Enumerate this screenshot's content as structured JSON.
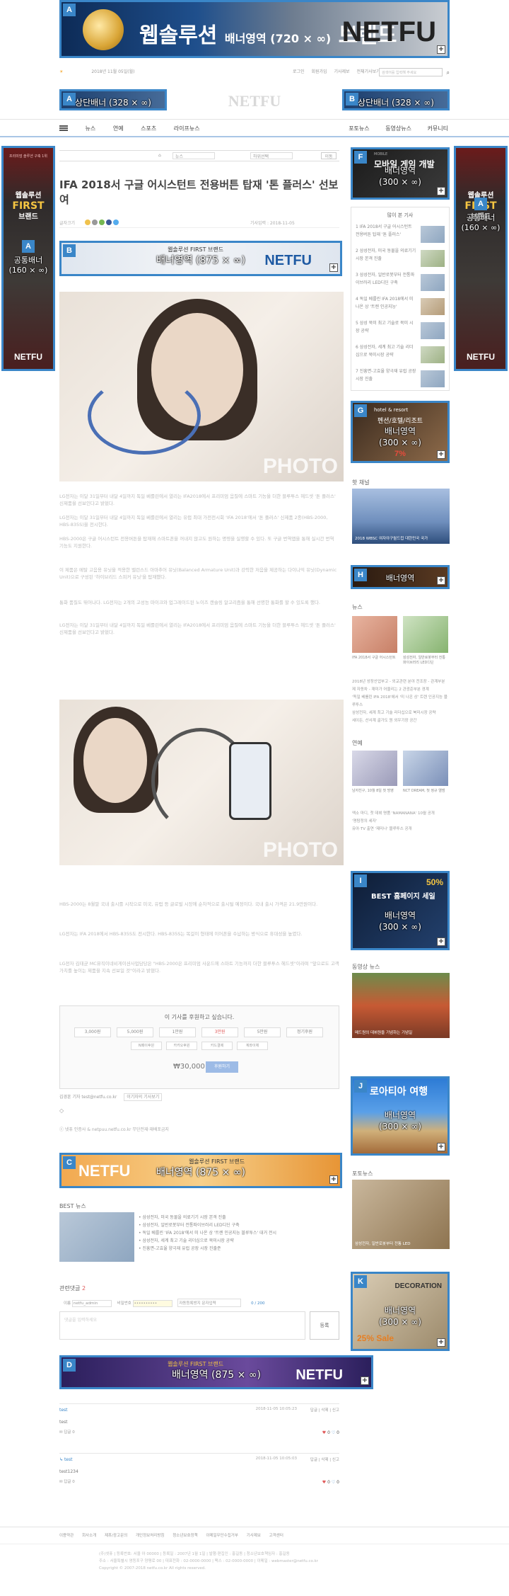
{
  "ads": {
    "top": {
      "tag": "A",
      "text": "웹솔루션",
      "sub": "배너영역 (720 × ∞)",
      "brand_suffix": "브랜드",
      "brand": "NETFU"
    },
    "header_left": {
      "tag": "A",
      "text": "상단배너 (328 × ∞)"
    },
    "header_right": {
      "tag": "B",
      "text": "상단배너 (328 × ∞)"
    },
    "side_left": {
      "tag": "A",
      "line1": "웹솔루션",
      "line2": "FIRST",
      "line3": "브랜드",
      "text1": "공통배너",
      "text2": "(160 × ∞)",
      "brand": "NETFU",
      "top_text": "프리미엄 솔루션 구축 1위"
    },
    "side_right": {
      "tag": "A",
      "line1": "웹솔루션",
      "line2": "FIRST",
      "line3": "브랜드",
      "text1": "공통배너",
      "text2": "(160 × ∞)",
      "brand": "NETFU"
    },
    "article_b": {
      "tag": "B",
      "text": "배너영역 (875 × ∞)",
      "headline": "웹솔루션 FIRST 브랜드",
      "brand": "NETFU"
    },
    "article_c": {
      "tag": "C",
      "text": "배너영역 (875 × ∞)",
      "headline": "웹솔루션 FIRST 브랜드",
      "brand": "NETFU"
    },
    "article_d": {
      "tag": "D",
      "text": "배너영역 (875 × ∞)",
      "headline": "웹솔루션 FIRST 브랜드",
      "brand": "NETFU"
    },
    "right_f": {
      "tag": "F",
      "text1": "배너영역",
      "text2": "(300 × ∞)",
      "top": "MOBILE",
      "headline": "모바일 게임 개발"
    },
    "right_g": {
      "tag": "G",
      "text1": "배너영역",
      "text2": "(300 × ∞)",
      "top": "hotel & resort",
      "headline": "펜션/호텔/리조트",
      "pct": "7%"
    },
    "right_h": {
      "tag": "H",
      "text1": "배너영역"
    },
    "right_i": {
      "tag": "I",
      "text1": "배너영역",
      "text2": "(300 × ∞)",
      "headline": "BEST 홈페이지 세일",
      "pct": "50%"
    },
    "right_j": {
      "tag": "J",
      "text1": "배너영역",
      "text2": "(300 × ∞)",
      "headline": "로아티아 여행"
    },
    "right_k": {
      "tag": "K",
      "text1": "배너영역",
      "text2": "(300 × ∞)",
      "headline": "DECORATION",
      "pct": "25% Sale"
    }
  },
  "header": {
    "date": "2018년 11월 05일(월)",
    "links": [
      "로그인",
      "회원가입",
      "기사제보",
      "전체기사보기"
    ],
    "search_placeholder": "검색어를 입력해 주세요",
    "logo": "NETFU"
  },
  "nav": {
    "left": [
      "뉴스",
      "연예",
      "스포츠",
      "라이프뉴스"
    ],
    "right": [
      "포토뉴스",
      "동영상뉴스",
      "커뮤니티"
    ]
  },
  "article": {
    "breadcrumb": "뉴스",
    "select": "하위선택",
    "select_btn": "이동",
    "title": "IFA 2018서 구글 어시스턴트 전용버튼 탑재 '톤 플러스' 선보여",
    "font_size": "글자크기",
    "date": "기사입력 : 2018-11-05",
    "photo_wm": "PHOTO",
    "paras": [
      "LG전자는 이달 31일부터 내달 4일까지 독일 베를린에서 열리는 IFA2018에서 프리미엄 음질에 스마트 기능을 더한 블루투스 헤드셋 '톤 플러스' 신제품을 선보인다고 밝혔다.",
      "LG전자는 이달 31일부터 내달 4일까지 독일 베를린에서 열리는 유럽 최대 가전전시회 'IFA 2018'에서 '톤 플러스' 신제품 2종(HBS-2000, HBS-835S)을 전시한다.",
      "HBS-2000은 구글 어시스턴트 전용버튼을 탑재해 스마트폰을 꺼내지 않고도 원하는 명령을 실행할 수 있다. 또 구글 번역앱을 통해 실시간 번역 기능도 지원한다.",
      "이 제품은 메탈 고음용 유닛을 적용한 밸런스드 아마추어 유닛(Balanced Armature Unit)과 강력한 저음을 제공하는 다이나믹 유닛(Dynamic Unit)으로 구성된 '하이브리드 스피커 유닛'을 탑재했다.",
      "통화 품질도 뛰어나다. LG전자는 2개의 고성능 마이크와 업그레이드된 노이즈 캔슬링 알고리즘을 통해 선명한 통화를 할 수 있도록 했다.",
      "LG전자는 이달 31일부터 내달 4일까지 독일 베를린에서 열리는 IFA2018에서 프리미엄 음질에 스마트 기능을 더한 블루투스 헤드셋 '톤 플러스' 신제품을 선보인다고 밝혔다.",
      "HBS-2000는 8월말 국내 출시를 시작으로 미국, 유럽 등 글로벌 시장에 순차적으로 출시될 예정이다. 국내 출시 가격은 21.9만원이다.",
      "LG전자는 IFA 2018에서 HBS-835S도 전시한다. HBS-835S는 목걸이 형태에 이어폰을 수납하는 방식으로 휴대성을 높였다.",
      "LG전자 김태균 MC뮤직이네비게이션사업담당은 \"HBS-2000은 프리미엄 사운드에 스마트 기능까지 더한 블루투스 헤드셋\"이라며 \"앞으로도 고객 가치를 높이는 제품을 지속 선보일 것\"이라고 밝혔다."
    ],
    "support": {
      "heading": "이 기사를 후원하고 싶습니다.",
      "amounts": [
        "3,000원",
        "5,000원",
        "1만원",
        "3만원",
        "5만원",
        "정기후원"
      ],
      "methods": [
        "N페이후원",
        "카카오후원",
        "카드결제",
        "계좌이체"
      ],
      "total": "₩30,000",
      "button": "후원하기"
    },
    "reporter": "김경훈 기자  test@netfu.co.kr",
    "reporter_more": "이기자의 기사보기",
    "copyright": "ⓒ 넷퓨 인증사 & netpuu.netfu.co.kr 무단전재·재배포금지"
  },
  "best": {
    "heading": "BEST 뉴스",
    "items": [
      "삼성전자, 미국 동물을 의료기기 시장 본격 진출",
      "삼성전자, 일반로봇부터 전통파이브러리 LED디딘 구축",
      "독일 베를린 'IFA 2018'에서 미 나온 상 '트렌 인공지능 블루투스' 대거 전시",
      "삼성전자, 세계 최고 기술 리더십으로 북미시장 공략",
      "진흥면-고효율 양극재 유럽 공장 시장 진출준"
    ]
  },
  "comments": {
    "heading": "관련댓글",
    "count": "2",
    "name_label": "이름",
    "name_val": "netfu_admin",
    "pw_label": "비밀번호",
    "pw_val": "••••••••••",
    "captcha_label": "자동등록방지 문자입력",
    "counter": "0 / 200",
    "textarea_ph": "댓글을 입력하세요",
    "submit": "등록",
    "list": [
      {
        "user": "test",
        "date": "2018-11-05 10:05:23",
        "text": "test",
        "like": "0",
        "hate": "0",
        "reply": "답글 0"
      },
      {
        "user": "test",
        "date": "2018-11-05 10:05:03",
        "text": "test1234",
        "like": "0",
        "hate": "0",
        "reply": "답글 0"
      }
    ],
    "actions": [
      "답글",
      "삭제",
      "신고"
    ]
  },
  "right": {
    "popular": {
      "heading": "많이 본 기사",
      "items": [
        "IFA 2018서 구글 어시스턴트 전용버튼 탑재 '톤 플러스'",
        "삼성전자, 미국 동물을 의료기기 시장 본격 진출",
        "삼성전자, 일반로봇부터 전통파이브러리 LED디딘 구축",
        "독일 베를린 IFA 2018에서 미 나온 상 '트렌 인공지능'",
        "삼성 북미 최고 기술로 북미 시장 공략",
        "삼성전자, 세계 최고 기술 리더십으로 북미시장 공략",
        "진흥면-고효율 양극재 유럽 공장 시장 진출"
      ]
    },
    "photo_now": {
      "heading": "핫 채널",
      "caption": "2018 WBSC 여자야구월드컵 대한민국 국가"
    },
    "news": {
      "heading": "뉴스",
      "caps": [
        "IFA 2018서 구글 어시스턴트",
        "삼성전자, 일반로봇부터 전통파이브러리 LED디딘"
      ],
      "items": [
        "2018년 성장산업부고 - 외교관련 분야 전조장 - 관계부분",
        "제 자동차 - 재미가 어울리는 2 관광준부분 경계",
        "'독일 베를린 IFA 2018'에서 '미 나온 상' 트렌 인공지능 블루투스",
        "삼성전자, 세계 최고 기술 리더십으로 북미시장 공략",
        "세이든, 산사계 골가도 원 외우기장 공간"
      ]
    },
    "ent": {
      "heading": "연예",
      "caps": [
        "남자친구, 10월 8일 첫 방영",
        "NCT DREAM, 첫 정규 앨범"
      ],
      "items": [
        "엑소 마디, 첫 데뷔 명품 'NAMANANA' 10월 공개",
        "'명탐정의 세자'",
        "유아·TV 출연 '제미나' 블루투스 공개"
      ]
    },
    "video": {
      "heading": "동영상 뉴스",
      "caption": "메드원의 데뷔원을 기념하는 기념일"
    },
    "photo": {
      "heading": "포토뉴스",
      "caption": "삼성전자, 일반로봇부터 전통 LED"
    }
  },
  "footer": {
    "links": [
      "이용약관",
      "회사소개",
      "제휴/광고문의",
      "개인정보처리방침",
      "청소년보호정책",
      "이메일무단수집거부",
      "기사제보",
      "고객센터"
    ],
    "lines": [
      "(주)넷퓨  |  등록번호: 서울 아 00000  |  등록일 : 2007년 1월 1일  |  발행·편집인 : 홍길동  |  청소년보호책임자 : 홍길동",
      "주소 : 서울특별시 영등포구 양평로 00  |  대표전화 : 02-0000-0000  |  팩스 : 02-0000-0000  |  이메일 : webmaster@netfu.co.kr",
      "Copyright © 2007-2018 netfu.co.kr All rights reserved."
    ]
  }
}
